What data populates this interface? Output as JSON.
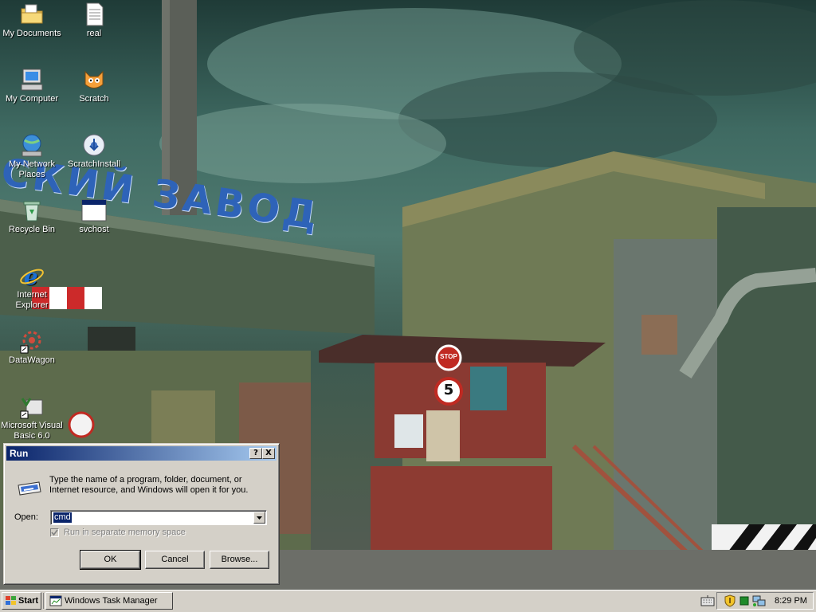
{
  "desktop": {
    "icons": [
      {
        "label": "My Documents",
        "icon": "folder-documents-icon"
      },
      {
        "label": "real",
        "icon": "text-file-icon"
      },
      {
        "label": "My Computer",
        "icon": "computer-icon"
      },
      {
        "label": "Scratch",
        "icon": "scratch-cat-icon"
      },
      {
        "label": "My Network Places",
        "icon": "network-places-icon"
      },
      {
        "label": "ScratchInstall",
        "icon": "installer-icon"
      },
      {
        "label": "Recycle Bin",
        "icon": "recycle-bin-icon"
      },
      {
        "label": "svchost",
        "icon": "program-window-icon"
      },
      {
        "label": "Internet Explorer",
        "icon": "internet-explorer-icon"
      },
      {
        "label": "DataWagon",
        "icon": "datawagon-icon"
      },
      {
        "label": "Microsoft Visual Basic 6.0",
        "icon": "visual-basic-icon"
      }
    ],
    "wallpaper_sign": "СКИЙ ЗАВОД",
    "booth_signs": [
      "STOP",
      "5"
    ]
  },
  "run_dialog": {
    "title": "Run",
    "help_label": "?",
    "close_label": "X",
    "description": "Type the name of a program, folder, document, or Internet resource, and Windows will open it for you.",
    "open_label": "Open:",
    "open_value": "cmd",
    "checkbox_label": "Run in separate memory space",
    "ok_label": "OK",
    "cancel_label": "Cancel",
    "browse_label": "Browse..."
  },
  "taskbar": {
    "start_label": "Start",
    "task_button_label": "Windows Task Manager",
    "clock": "8:29 PM"
  }
}
